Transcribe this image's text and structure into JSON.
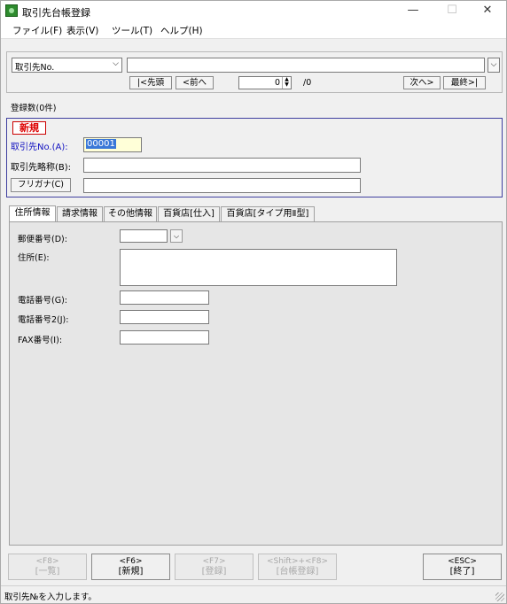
{
  "window": {
    "title": "取引先台帳登録",
    "min": "—",
    "max": "☐",
    "close": "✕"
  },
  "menu": [
    "ファイル(F)",
    "表示(V)",
    "ツール(T)",
    "ヘルプ(H)"
  ],
  "search": {
    "key_field": "取引先No.",
    "first": "|<先頭",
    "prev": "<前へ",
    "page": "0",
    "total": "/0",
    "next": "次へ>",
    "last": "最終>|"
  },
  "count_label": "登録数(0件)",
  "record": {
    "mode_badge": "新規",
    "no_label": "取引先No.(A):",
    "no_value": "00001",
    "short_name_label": "取引先略称(B):",
    "short_name_value": "",
    "furigana_button": "フリガナ(C)",
    "furigana_value": ""
  },
  "tabs": [
    "住所情報",
    "請求情報",
    "その他情報",
    "百貨店[仕入]",
    "百貨店[タイプ用Ⅱ型]"
  ],
  "address": {
    "zip_label": "郵便番号(D):",
    "address_label": "住所(E):",
    "phone_label": "電話番号(G):",
    "phone2_label": "電話番号2(J):",
    "fax_label": "FAX番号(I):"
  },
  "fkeys": {
    "f8": {
      "key": "<F8>",
      "label": "[一覧]"
    },
    "f6": {
      "key": "<F6>",
      "label": "[新規]"
    },
    "f7": {
      "key": "<F7>",
      "label": "[登録]"
    },
    "shift_f8": {
      "key": "<Shift>+<F8>",
      "label": "[台帳登録]"
    },
    "esc": {
      "key": "<ESC>",
      "label": "[終了]"
    }
  },
  "status": "取引先№を入力します。"
}
